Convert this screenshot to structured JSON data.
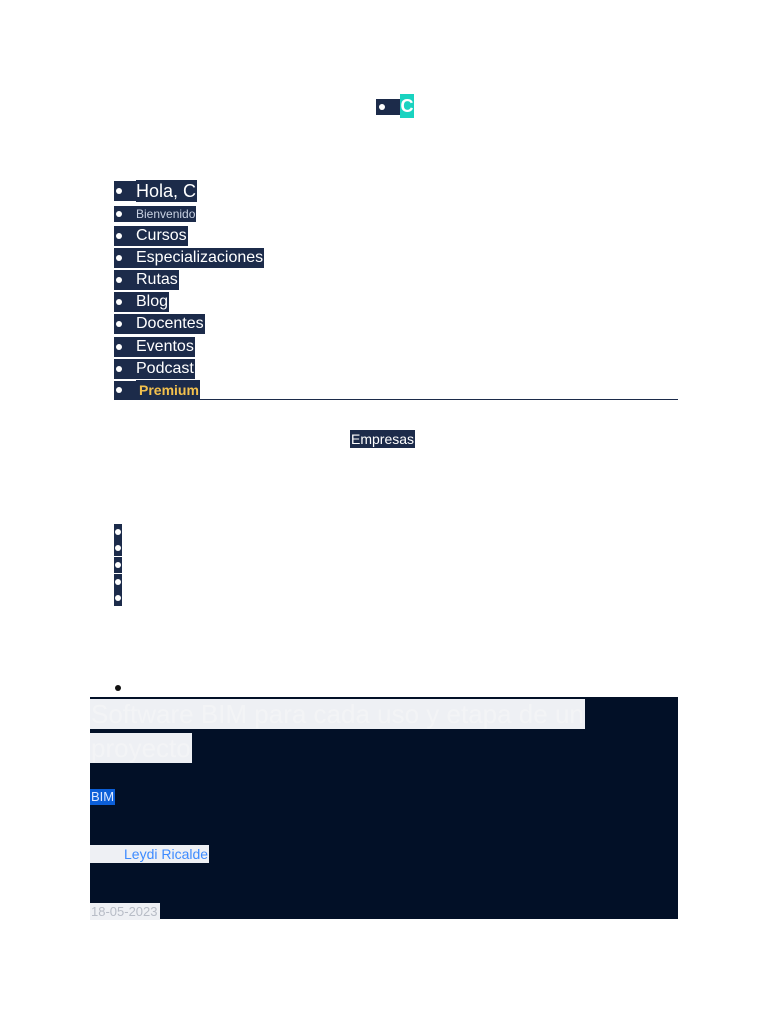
{
  "header": {
    "avatar_initial": "C"
  },
  "menu": {
    "greeting": "Hola, C",
    "welcome": "Bienvenido",
    "items": [
      {
        "label": "Cursos"
      },
      {
        "label": "Especializaciones"
      },
      {
        "label": "Rutas"
      },
      {
        "label": "Blog"
      },
      {
        "label": "Docentes"
      },
      {
        "label": "Eventos"
      },
      {
        "label": "Podcast"
      }
    ],
    "premium_label": "Premium"
  },
  "business_link": "Empresas",
  "article": {
    "title": "Software BIM para cada uso y etapa de un proyecto",
    "tag": "BIM",
    "author": "Leydi Ricalde",
    "date": "18-05-2023"
  },
  "colors": {
    "nav_highlight": "#1c2b4a",
    "avatar_bg": "#19d3c0",
    "premium": "#f2c04d",
    "card_bg": "#021027",
    "link": "#3d8bff"
  }
}
